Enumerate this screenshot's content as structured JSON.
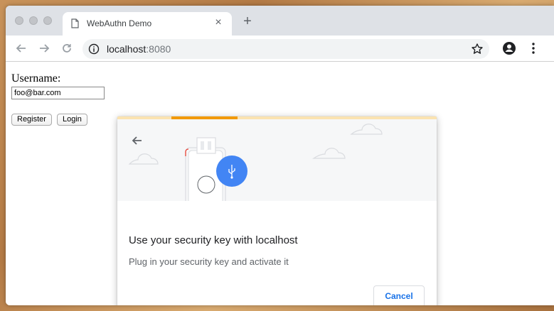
{
  "browser": {
    "tab_title": "WebAuthn Demo",
    "new_tab_symbol": "+",
    "tab_close_symbol": "×",
    "url_host": "localhost",
    "url_port": ":8080"
  },
  "page": {
    "username_label": "Username:",
    "username_value": "foo@bar.com",
    "register_label": "Register",
    "login_label": "Login"
  },
  "dialog": {
    "title": "Use your security key with localhost",
    "description": "Plug in your security key and activate it",
    "cancel_label": "Cancel",
    "progress_color": "#f29900",
    "accent_color": "#1a73e8"
  },
  "icons": [
    "page-icon",
    "back-arrow-icon",
    "forward-arrow-icon",
    "reload-icon",
    "info-icon",
    "star-icon",
    "profile-icon",
    "menu-icon",
    "security-key-icon",
    "usb-icon",
    "cloud-icon"
  ]
}
